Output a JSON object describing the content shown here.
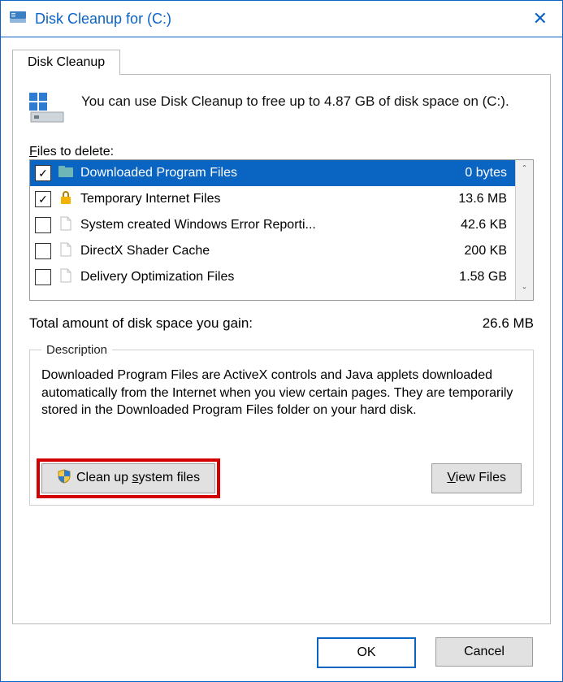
{
  "window": {
    "title": "Disk Cleanup for  (C:)"
  },
  "tab": {
    "label": "Disk Cleanup"
  },
  "intro": {
    "text": "You can use Disk Cleanup to free up to 4.87 GB of disk space on  (C:)."
  },
  "files_label": "Files to delete:",
  "files": [
    {
      "checked": true,
      "icon": "folder",
      "name": "Downloaded Program Files",
      "size": "0 bytes",
      "selected": true
    },
    {
      "checked": true,
      "icon": "lock",
      "name": "Temporary Internet Files",
      "size": "13.6 MB",
      "selected": false
    },
    {
      "checked": false,
      "icon": "file",
      "name": "System created Windows Error Reporti...",
      "size": "42.6 KB",
      "selected": false
    },
    {
      "checked": false,
      "icon": "file",
      "name": "DirectX Shader Cache",
      "size": "200 KB",
      "selected": false
    },
    {
      "checked": false,
      "icon": "file",
      "name": "Delivery Optimization Files",
      "size": "1.58 GB",
      "selected": false
    }
  ],
  "totals": {
    "label": "Total amount of disk space you gain:",
    "value": "26.6 MB"
  },
  "description": {
    "legend": "Description",
    "text": "Downloaded Program Files are ActiveX controls and Java applets downloaded automatically from the Internet when you view certain pages. They are temporarily stored in the Downloaded Program Files folder on your hard disk."
  },
  "buttons": {
    "cleanup_system": "Clean up system files",
    "cleanup_system_ul": "s",
    "view_files_pre": "",
    "view_files_ul": "V",
    "view_files_post": "iew Files",
    "ok": "OK",
    "cancel": "Cancel"
  }
}
